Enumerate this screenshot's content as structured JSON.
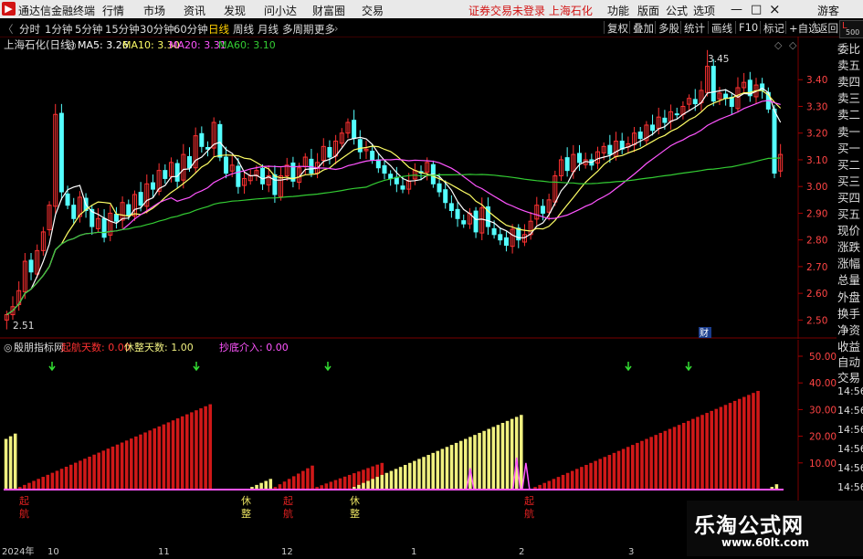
{
  "app": {
    "title": "通达信金融终端",
    "logo": "TDX"
  },
  "menu": [
    "行情",
    "市场",
    "资讯",
    "发现",
    "问小达",
    "财富圈",
    "交易"
  ],
  "notice": "证券交易未登录  上海石化",
  "menu_right": [
    "功能",
    "版面",
    "公式",
    "选项",
    "游客"
  ],
  "window_controls": {
    "minimize": "—",
    "restore": "□",
    "close": "×"
  },
  "periods": [
    "分时",
    "1分钟",
    "5分钟",
    "15分钟",
    "30分钟",
    "60分钟",
    "日线",
    "周线",
    "月线",
    "多周期",
    "更多"
  ],
  "active_period": "日线",
  "toolbar_right": [
    "复权",
    "叠加",
    "多股",
    "统计",
    "画线",
    "F10",
    "标记",
    "+自选",
    "返回"
  ],
  "l_badge": {
    "l": "L",
    "num": "500"
  },
  "chart_title": {
    "name": "上海石化(日线)",
    "ma5": "MA5: 3.26",
    "ma10": "MA10: 3.30",
    "ma20": "MA20: 3.31",
    "ma60": "MA60: 3.10"
  },
  "indicator_title": {
    "name": "殷朋指标网",
    "a": "起航天数: 0.00",
    "b": "休整天数: 1.00",
    "c": "抄底介入: 0.00"
  },
  "price_high_label": "3.45",
  "price_low_label": "2.51",
  "cai_label": "财",
  "side_panel": [
    "委比",
    "卖五",
    "卖四",
    "卖三",
    "卖二",
    "卖一",
    "买一",
    "买二",
    "买三",
    "买四",
    "买五",
    "现价",
    "涨跌",
    "涨幅",
    "总量",
    "外盘",
    "换手",
    "净资",
    "收益"
  ],
  "side_panel2": [
    "自动",
    "交易"
  ],
  "time_axis": [
    "2024年",
    "10",
    "11",
    "12",
    "1",
    "2",
    "3"
  ],
  "signal_labels": [
    {
      "top": "起",
      "bottom": "航",
      "color": "#e02020"
    },
    {
      "top": "休",
      "bottom": "整",
      "color": "#e8e060"
    },
    {
      "top": "起",
      "bottom": "航",
      "color": "#e02020"
    },
    {
      "top": "休",
      "bottom": "整",
      "color": "#e8e060"
    },
    {
      "top": "起",
      "bottom": "航",
      "color": "#e02020"
    }
  ],
  "right_time_labels": [
    "14:56",
    "14:56",
    "14:56",
    "14:56",
    "14:56",
    "14:56",
    "14:56"
  ],
  "watermark": {
    "cn": "乐淘公式网",
    "url": "www.60lt.com"
  },
  "colors": {
    "up": "#ff3232",
    "down": "#54ffff",
    "ma5": "#ffffff",
    "ma10": "#ffff66",
    "ma20": "#ff55ff",
    "ma60": "#33cc33",
    "bar_red": "#d01818",
    "bar_yellow": "#f0f080",
    "accent": "#d21414"
  },
  "chart_data": [
    {
      "type": "candlestick",
      "title": "上海石化(日线)",
      "ylim": [
        2.45,
        3.5
      ],
      "yticks": [
        2.5,
        2.6,
        2.7,
        2.8,
        2.9,
        3.0,
        3.1,
        3.2,
        3.3,
        3.4
      ],
      "series": [
        {
          "name": "MA5",
          "values": []
        },
        {
          "name": "MA10",
          "values": []
        },
        {
          "name": "MA20",
          "values": []
        },
        {
          "name": "MA60",
          "values": []
        }
      ],
      "close": [
        2.52,
        2.55,
        2.61,
        2.72,
        2.68,
        2.76,
        2.83,
        2.93,
        3.27,
        2.98,
        2.93,
        2.88,
        2.96,
        2.91,
        2.85,
        2.88,
        2.81,
        2.9,
        2.87,
        2.94,
        2.89,
        2.97,
        2.93,
        3.01,
        2.99,
        3.06,
        3.03,
        3.09,
        3.02,
        3.12,
        3.07,
        3.19,
        3.15,
        3.14,
        3.24,
        3.11,
        3.05,
        3.08,
        3.0,
        3.03,
        3.04,
        3.06,
        3.01,
        3.04,
        2.97,
        3.04,
        3.08,
        3.02,
        3.07,
        3.11,
        3.05,
        3.09,
        3.15,
        3.11,
        3.17,
        3.2,
        3.24,
        3.18,
        3.13,
        3.14,
        3.1,
        3.07,
        3.05,
        3.03,
        3.01,
        2.99,
        3.02,
        3.06,
        3.05,
        3.09,
        3.01,
        2.98,
        2.94,
        2.91,
        2.88,
        2.86,
        2.9,
        2.83,
        2.92,
        2.85,
        2.82,
        2.8,
        2.78,
        2.84,
        2.8,
        2.82,
        2.87,
        2.93,
        2.9,
        2.95,
        3.04,
        3.1,
        3.06,
        3.12,
        3.09,
        3.1,
        3.08,
        3.13,
        3.15,
        3.12,
        3.17,
        3.14,
        3.16,
        3.2,
        3.18,
        3.23,
        3.21,
        3.26,
        3.24,
        3.28,
        3.27,
        3.3,
        3.33,
        3.31,
        3.36,
        3.45,
        3.32,
        3.35,
        3.33,
        3.3,
        3.37,
        3.39,
        3.34,
        3.38,
        3.36,
        3.29,
        3.05,
        3.12
      ],
      "volume_note": ""
    },
    {
      "type": "bar",
      "title": "殷朋指标网",
      "ylim": [
        0,
        50
      ],
      "yticks": [
        10,
        20,
        30,
        40,
        50
      ],
      "series": [
        {
          "name": "起航天数",
          "color": "#d01818",
          "values": []
        },
        {
          "name": "休整天数",
          "color": "#f0f080",
          "values": []
        },
        {
          "name": "抄底介入",
          "color": "#ff55ff",
          "values": []
        }
      ],
      "segments": [
        {
          "type": "yellow",
          "start": 0,
          "len": 3,
          "from": 19,
          "to": 21
        },
        {
          "type": "red",
          "start": 3,
          "len": 42,
          "from": 1,
          "to": 32
        },
        {
          "type": "yellow",
          "start": 53,
          "len": 5,
          "from": 1,
          "to": 4
        },
        {
          "type": "red",
          "start": 58,
          "len": 9,
          "from": 1,
          "to": 9
        },
        {
          "type": "red",
          "start": 67,
          "len": 15,
          "from": 1,
          "to": 10
        },
        {
          "type": "yellow",
          "start": 75,
          "len": 37,
          "from": 1,
          "to": 28
        },
        {
          "type": "red",
          "start": 114,
          "len": 49,
          "from": 1,
          "to": 37
        },
        {
          "type": "yellow",
          "start": 165,
          "len": 2,
          "from": 1,
          "to": 2
        }
      ]
    }
  ]
}
